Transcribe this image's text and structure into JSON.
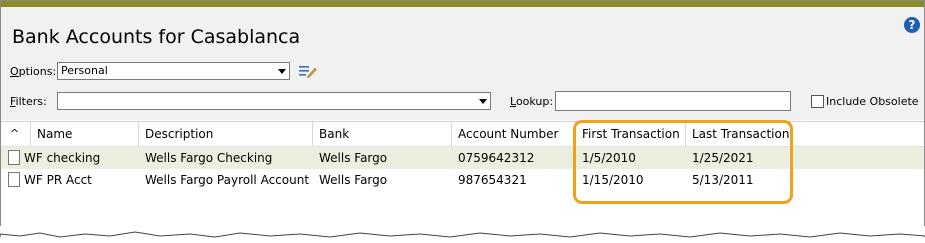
{
  "window": {
    "title": "Bank Accounts for Casablanca",
    "help_glyph": "?"
  },
  "options": {
    "label_prefix": "O",
    "label_rest": "ptions:",
    "value": "Personal"
  },
  "filters": {
    "label_prefix": "F",
    "label_rest": "ilters:",
    "value": ""
  },
  "lookup": {
    "label_prefix": "L",
    "label_rest": "ookup:",
    "value": ""
  },
  "include_obsolete": {
    "label": "Include Obsolete",
    "checked": false
  },
  "table": {
    "sort_glyph": "^",
    "columns": [
      "Name",
      "Description",
      "Bank",
      "Account Number",
      "First Transaction",
      "Last Transaction"
    ],
    "rows": [
      {
        "name": "WF checking",
        "description": "Wells Fargo Checking",
        "bank": "Wells Fargo",
        "account_number": "0759642312",
        "first": "1/5/2010",
        "last": "1/25/2021",
        "selected": true
      },
      {
        "name": "WF PR Acct",
        "description": "Wells Fargo Payroll Account",
        "bank": "Wells Fargo",
        "account_number": "987654321",
        "first": "1/15/2010",
        "last": "5/13/2011",
        "selected": false
      }
    ]
  },
  "colors": {
    "accent_bar": "#8b8b22",
    "highlight": "#f0a31a",
    "selected_row": "#ecefdf",
    "help_icon": "#1e5fb4"
  },
  "icons": [
    "help-icon",
    "edit-list-icon",
    "dropdown-arrow-icon",
    "document-icon",
    "sort-up-icon"
  ]
}
